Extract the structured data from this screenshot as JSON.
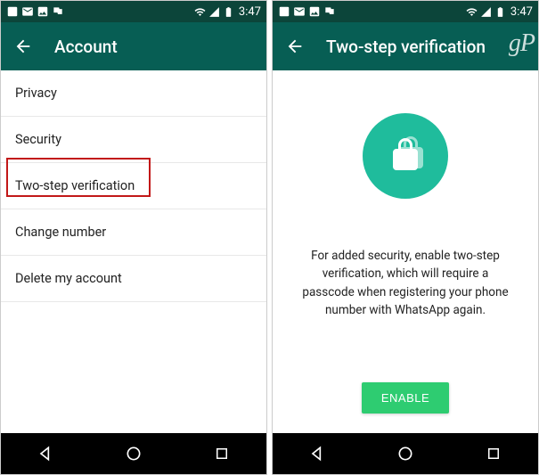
{
  "status": {
    "time": "3:47"
  },
  "left": {
    "title": "Account",
    "items": [
      "Privacy",
      "Security",
      "Two-step verification",
      "Change number",
      "Delete my account"
    ],
    "highlighted_index": 2
  },
  "right": {
    "title": "Two-step verification",
    "watermark": "gP",
    "description": "For added security, enable two-step verification, which will require a passcode when registering your phone number with WhatsApp again.",
    "button": "ENABLE"
  },
  "colors": {
    "statusbar": "#0c453a",
    "appbar": "#075e54",
    "accent": "#1fbc9c",
    "button": "#2ecc71",
    "highlight": "#c21818"
  }
}
